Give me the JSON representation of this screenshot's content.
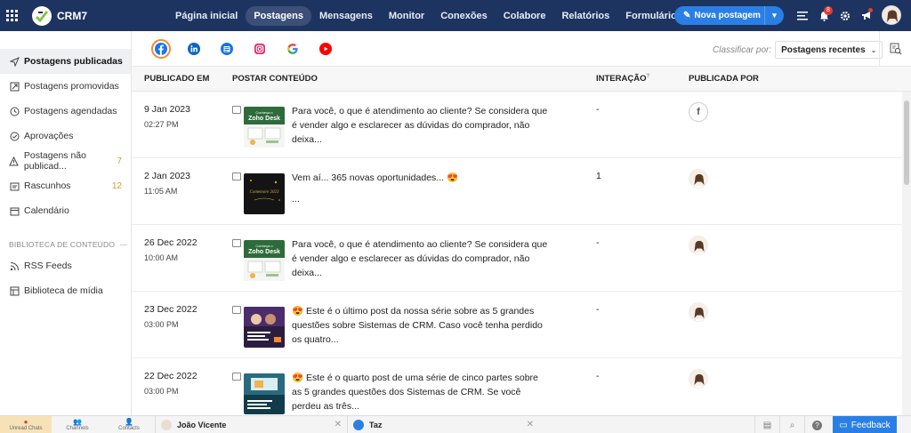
{
  "app": {
    "name": "CRM7"
  },
  "nav": {
    "items": [
      {
        "label": "Página inicial"
      },
      {
        "label": "Postagens",
        "active": true
      },
      {
        "label": "Mensagens"
      },
      {
        "label": "Monitor"
      },
      {
        "label": "Conexões"
      },
      {
        "label": "Colabore"
      },
      {
        "label": "Relatórios"
      },
      {
        "label": "Formulários de leads"
      }
    ],
    "new_post_label": "Nova postagem"
  },
  "topbar": {
    "notification_count": "8"
  },
  "sidebar": {
    "items": [
      {
        "label": "Postagens publicadas",
        "icon": "send-icon",
        "active": true
      },
      {
        "label": "Postagens promovidas",
        "icon": "promote-icon"
      },
      {
        "label": "Postagens agendadas",
        "icon": "clock-icon"
      },
      {
        "label": "Aprovações",
        "icon": "check-circle-icon"
      },
      {
        "label": "Postagens não publicad...",
        "icon": "warning-icon",
        "count": "7"
      },
      {
        "label": "Rascunhos",
        "icon": "drafts-icon",
        "count": "12"
      },
      {
        "label": "Calendário",
        "icon": "calendar-icon"
      }
    ],
    "library_title": "BIBLIOTECA DE CONTEÚDO",
    "library_items": [
      {
        "label": "RSS Feeds",
        "icon": "rss-icon"
      },
      {
        "label": "Biblioteca de mídia",
        "icon": "media-library-icon"
      }
    ]
  },
  "social_channels": [
    "facebook-icon",
    "linkedin-icon",
    "google-business-icon",
    "instagram-icon",
    "google-icon",
    "youtube-icon"
  ],
  "sort": {
    "label": "Classificar por:",
    "value": "Postagens recentes"
  },
  "table": {
    "headers": {
      "date": "PUBLICADO EM",
      "content": "POSTAR CONTEÚDO",
      "interaction": "INTERAÇÃO",
      "interaction_sup": "?",
      "by": "PUBLICADA POR"
    },
    "rows": [
      {
        "date": "9 Jan 2023",
        "time": "02:27 PM",
        "text": "Para você, o que é atendimento ao cliente? Se considera que é vender algo e esclarecer as dúvidas do comprador, não deixa...",
        "interaction": "-",
        "by": "facebook"
      },
      {
        "date": "2 Jan 2023",
        "time": "11:05 AM",
        "text": "Vem aí... 365 novas oportunidades... 😍",
        "text2": "...",
        "interaction": "1",
        "by": "avatar"
      },
      {
        "date": "26 Dec 2022",
        "time": "10:00 AM",
        "text": "Para você, o que é atendimento ao cliente? Se considera que é vender algo e esclarecer as dúvidas do comprador, não deixa...",
        "interaction": "-",
        "by": "avatar"
      },
      {
        "date": "23 Dec 2022",
        "time": "03:00 PM",
        "text": "😍 Este é o último post da nossa série sobre as 5 grandes questões sobre Sistemas de CRM. Caso você tenha perdido os quatro...",
        "interaction": "-",
        "by": "avatar"
      },
      {
        "date": "22 Dec 2022",
        "time": "03:00 PM",
        "text": "😍 Este é o quarto post de uma série de cinco partes sobre as 5 grandes questões dos Sistemas de CRM. Se você perdeu as três...",
        "interaction": "-",
        "by": "avatar"
      }
    ]
  },
  "thumbs": {
    "zoho_title": "Zoho Desk",
    "zoho_sub": "Conheça o",
    "newyear_text": "Comemore 2023"
  },
  "bottombar": {
    "unread_chats": "Unread Chats",
    "channels": "Channels",
    "contacts": "Contacts",
    "chat1": "João Vicente",
    "chat2": "Taz",
    "feedback": "Feedback"
  }
}
